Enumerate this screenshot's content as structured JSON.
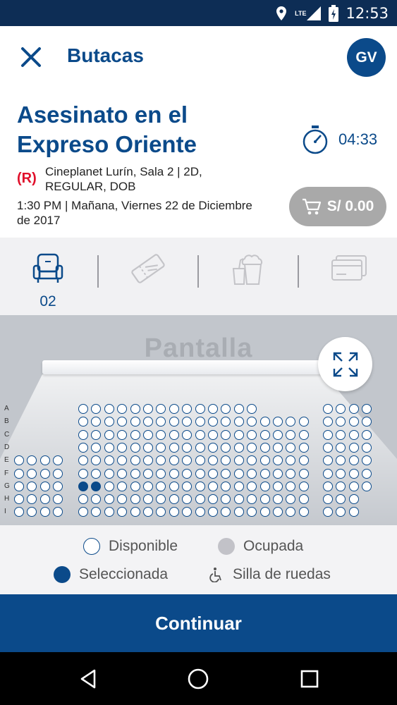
{
  "status_bar": {
    "time": "12:53",
    "network": "LTE"
  },
  "app_bar": {
    "title": "Butacas",
    "avatar_initials": "GV"
  },
  "movie": {
    "title": "Asesinato en el Expreso Oriente",
    "timer": "04:33",
    "brand_mark": "(R)",
    "cinema": "Cineplanet Lurín, Sala 2 | 2D, REGULAR, DOB",
    "datetime": "1:30 PM | Mañana, Viernes 22 de Diciembre de 2017",
    "cart_total": "S/ 0.00"
  },
  "steps": [
    {
      "icon": "seat-icon",
      "label": "02",
      "active": true
    },
    {
      "icon": "ticket-icon",
      "label": "",
      "active": false
    },
    {
      "icon": "snack-icon",
      "label": "",
      "active": false
    },
    {
      "icon": "card-icon",
      "label": "",
      "active": false
    }
  ],
  "seatmap": {
    "screen_label": "Pantalla",
    "rows": [
      "A",
      "B",
      "C",
      "D",
      "E",
      "F",
      "G",
      "H",
      "I"
    ],
    "selected_seats": [
      [
        "G",
        1
      ],
      [
        "G",
        2
      ]
    ]
  },
  "legend": {
    "available": "Disponible",
    "occupied": "Ocupada",
    "selected": "Seleccionada",
    "wheelchair": "Silla de ruedas"
  },
  "continue_label": "Continuar",
  "colors": {
    "brand": "#0b4a8a",
    "status_bar": "#0d2d55",
    "occupied": "#c2c2c8",
    "logo_red": "#e0102b"
  }
}
